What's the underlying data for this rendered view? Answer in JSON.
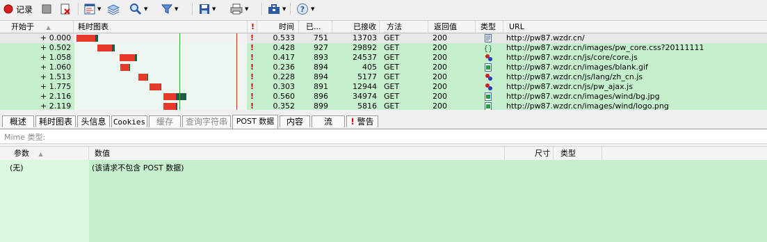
{
  "toolbar": {
    "record_label": "记录",
    "icons": [
      "record-icon",
      "stop-icon",
      "clear-icon",
      "view-icon",
      "layers-icon",
      "find-icon",
      "filter-icon",
      "save-icon",
      "print-icon",
      "toolbox-icon",
      "help-icon"
    ]
  },
  "request_list": {
    "columns": [
      "开始于",
      "耗时图表",
      "!",
      "时间",
      "已...",
      "已接收",
      "方法",
      "返回值",
      "类型",
      "URL"
    ],
    "rows": [
      {
        "start": "+ 0.000",
        "flag": "!",
        "time": "0.533",
        "sent": "751",
        "received": "13703",
        "method": "GET",
        "status": "200",
        "type": "html",
        "url": "http://pw87.wzdr.cn/",
        "bar_red_start": 0.0,
        "bar_red_dur": 0.45,
        "bar_green_dur": 0.08
      },
      {
        "start": "+ 0.502",
        "flag": "!",
        "time": "0.428",
        "sent": "927",
        "received": "29892",
        "method": "GET",
        "status": "200",
        "type": "css",
        "url": "http://pw87.wzdr.cn/images/pw_core.css?20111111",
        "bar_red_start": 0.502,
        "bar_red_dur": 0.37,
        "bar_green_dur": 0.06
      },
      {
        "start": "+ 1.058",
        "flag": "!",
        "time": "0.417",
        "sent": "893",
        "received": "24537",
        "method": "GET",
        "status": "200",
        "type": "js",
        "url": "http://pw87.wzdr.cn/js/core/core.js",
        "bar_red_start": 1.058,
        "bar_red_dur": 0.36,
        "bar_green_dur": 0.06
      },
      {
        "start": "+ 1.060",
        "flag": "!",
        "time": "0.236",
        "sent": "894",
        "received": "405",
        "method": "GET",
        "status": "200",
        "type": "image",
        "url": "http://pw87.wzdr.cn/images/blank.gif",
        "bar_red_start": 1.06,
        "bar_red_dur": 0.22,
        "bar_green_dur": 0.02
      },
      {
        "start": "+ 1.513",
        "flag": "!",
        "time": "0.228",
        "sent": "894",
        "received": "5177",
        "method": "GET",
        "status": "200",
        "type": "js",
        "url": "http://pw87.wzdr.cn/js/lang/zh_cn.js",
        "bar_red_start": 1.513,
        "bar_red_dur": 0.21,
        "bar_green_dur": 0.02
      },
      {
        "start": "+ 1.775",
        "flag": "!",
        "time": "0.303",
        "sent": "891",
        "received": "12944",
        "method": "GET",
        "status": "200",
        "type": "js",
        "url": "http://pw87.wzdr.cn/js/pw_ajax.js",
        "bar_red_start": 1.775,
        "bar_red_dur": 0.28,
        "bar_green_dur": 0.02
      },
      {
        "start": "+ 2.116",
        "flag": "!",
        "time": "0.560",
        "sent": "896",
        "received": "34974",
        "method": "GET",
        "status": "200",
        "type": "image",
        "url": "http://pw87.wzdr.cn/images/wind/bg.jpg",
        "bar_red_start": 2.116,
        "bar_red_dur": 0.3,
        "bar_green_dur": 0.26
      },
      {
        "start": "+ 2.119",
        "flag": "!",
        "time": "0.352",
        "sent": "899",
        "received": "5816",
        "method": "GET",
        "status": "200",
        "type": "image",
        "url": "http://pw87.wzdr.cn/images/wind/logo.png",
        "bar_red_start": 2.119,
        "bar_red_dur": 0.3,
        "bar_green_dur": 0.04
      }
    ]
  },
  "tabs": [
    {
      "label": "概述",
      "state": "normal"
    },
    {
      "label": "耗时图表",
      "state": "normal"
    },
    {
      "label": "头信息",
      "state": "normal"
    },
    {
      "label": "Cookies",
      "state": "normal"
    },
    {
      "label": "缓存",
      "state": "disabled"
    },
    {
      "label": "查询字符串",
      "state": "disabled"
    },
    {
      "label": "POST 数据",
      "state": "active"
    },
    {
      "label": "内容",
      "state": "normal"
    },
    {
      "label": "流",
      "state": "normal"
    },
    {
      "label": "警告",
      "state": "normal"
    }
  ],
  "mime_label": "Mime 类型:",
  "post_table": {
    "columns": [
      "参数",
      "数值",
      "尺寸",
      "类型"
    ],
    "rows": [
      {
        "param": "(无)",
        "value": "(该请求不包含 POST 数据)"
      }
    ]
  }
}
